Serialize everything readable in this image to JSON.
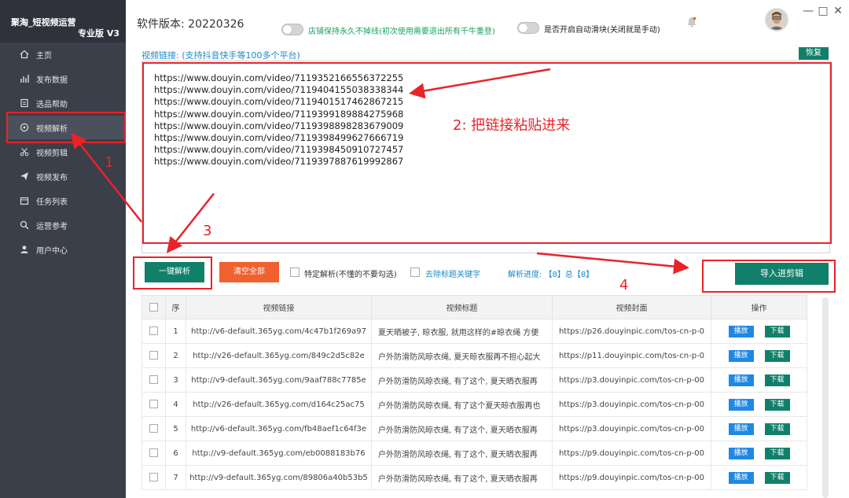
{
  "app": {
    "title": "聚淘_短视频运营",
    "edition": "专业版 V3"
  },
  "sidebar": {
    "items": [
      {
        "label": "主页",
        "icon": "home-icon"
      },
      {
        "label": "发布数据",
        "icon": "bar-chart-icon"
      },
      {
        "label": "选品帮助",
        "icon": "document-icon"
      },
      {
        "label": "视频解析",
        "icon": "compass-icon",
        "active": true
      },
      {
        "label": "视频剪辑",
        "icon": "scissors-icon"
      },
      {
        "label": "视频发布",
        "icon": "send-icon"
      },
      {
        "label": "任务列表",
        "icon": "calendar-icon"
      },
      {
        "label": "运营参考",
        "icon": "search-icon"
      },
      {
        "label": "用户中心",
        "icon": "user-icon"
      }
    ]
  },
  "header": {
    "version": "软件版本: 20220326",
    "toggle1_label": "店铺保持永久不掉线(初次使用需要退出所有千牛重登)",
    "toggle2_label": "是否开启自动滑块(关闭就是手动)"
  },
  "input": {
    "label": "视频链接: (支持抖音快手等100多个平台)",
    "restore": "恢复",
    "urls": [
      "https://www.douyin.com/video/7119352166556372255",
      "https://www.douyin.com/video/7119404155038338344",
      "https://www.douyin.com/video/7119401517462867215",
      "https://www.douyin.com/video/7119399189884275968",
      "https://www.douyin.com/video/7119398898283679009",
      "https://www.douyin.com/video/7119398499627666719",
      "https://www.douyin.com/video/7119398450910727457",
      "https://www.douyin.com/video/7119397887619992867"
    ]
  },
  "toolbar": {
    "parse": "一键解析",
    "clear": "清空全部",
    "specific_parse": "特定解析(不懂的不要勾选)",
    "remove_keywords": "去除标题关键字",
    "progress": "解析进度: 【8】总【8】",
    "import": "导入进剪辑"
  },
  "table": {
    "headers": [
      "序",
      "视频链接",
      "视频标题",
      "视频封面",
      "操作"
    ],
    "play": "播放",
    "download": "下载",
    "rows": [
      {
        "n": "1",
        "link": "http://v6-default.365yg.com/4c47b1f269a97",
        "title": "夏天晒被子, 晾衣服, 就用这样的#晾衣绳 方便",
        "cover": "https://p26.douyinpic.com/tos-cn-p-0"
      },
      {
        "n": "2",
        "link": "http://v26-default.365yg.com/849c2d5c82e",
        "title": "户外防滑防风晾衣绳, 夏天晾衣服再不担心起大",
        "cover": "https://p11.douyinpic.com/tos-cn-p-0"
      },
      {
        "n": "3",
        "link": "http://v9-default.365yg.com/9aaf788c7785e",
        "title": "户外防滑防风晾衣绳, 有了这个, 夏天晒衣服再",
        "cover": "https://p3.douyinpic.com/tos-cn-p-00"
      },
      {
        "n": "4",
        "link": "http://v26-default.365yg.com/d164c25ac75",
        "title": "户外防滑防风晾衣绳, 有了这个夏天晾衣服再也",
        "cover": "https://p3.douyinpic.com/tos-cn-p-00"
      },
      {
        "n": "5",
        "link": "http://v6-default.365yg.com/fb48aef1c64f3e",
        "title": "户外防滑防风晾衣绳, 有了这个, 夏天晒衣服再",
        "cover": "https://p3.douyinpic.com/tos-cn-p-00"
      },
      {
        "n": "6",
        "link": "http://v9-default.365yg.com/eb0088183b76",
        "title": "户外防滑防风晾衣绳, 有了这个, 夏天晒衣服再",
        "cover": "https://p9.douyinpic.com/tos-cn-p-00"
      },
      {
        "n": "7",
        "link": "http://v9-default.365yg.com/89806a40b53b5",
        "title": "户外防滑防风晾衣绳, 有了这个, 夏天晒衣服再",
        "cover": "https://p9.douyinpic.com/tos-cn-p-00"
      }
    ]
  },
  "annotations": {
    "step1": "1",
    "step2": "2: 把链接粘贴进来",
    "step3": "3",
    "step4": "4"
  },
  "colors": {
    "accent_green": "#11806a",
    "accent_orange": "#f0612f",
    "link_blue": "#1e88c8",
    "annotation_red": "#e8232a",
    "sidebar": "#3b3f4a"
  }
}
